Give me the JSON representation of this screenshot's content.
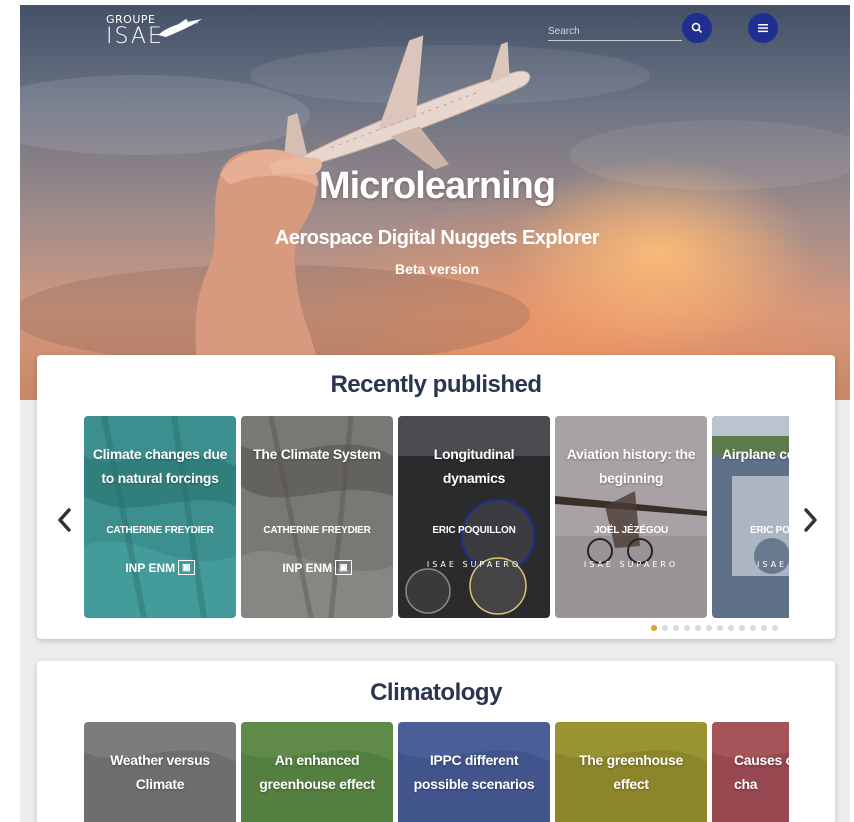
{
  "brand": {
    "logo_top": "GROUPE",
    "logo_main": "ISAE"
  },
  "header": {
    "search_placeholder": "Search",
    "search_icon": "search-icon",
    "menu_icon": "menu-icon"
  },
  "hero": {
    "title": "Microlearning",
    "subtitle": "Aerospace Digital Nuggets Explorer",
    "beta": "Beta version"
  },
  "recently": {
    "title": "Recently published",
    "cards": [
      {
        "title": "Climate changes due to natural forcings",
        "author": "CATHERINE FREYDIER",
        "logo": "INP ENM"
      },
      {
        "title": "The Climate System",
        "author": "CATHERINE FREYDIER",
        "logo": "INP ENM"
      },
      {
        "title": "Longitudinal dynamics",
        "author": "ERIC POQUILLON",
        "logo": "ISAE SUPAERO"
      },
      {
        "title": "Aviation history: the beginning",
        "author": "JOËL JÉZÉGOU",
        "logo": "ISAE SUPAERO"
      },
      {
        "title": "Airplane co",
        "author": "ERIC POC",
        "logo": "ISAE SUPA"
      }
    ],
    "dots_total": 12,
    "dots_active": 0,
    "colors": {
      "active_dot": "#e69a3a",
      "inactive_dot": "#d9d9d9"
    }
  },
  "climatology": {
    "title": "Climatology",
    "cards": [
      {
        "title": "Weather versus Climate"
      },
      {
        "title": "An enhanced greenhouse effect"
      },
      {
        "title": "IPPC different possible scenarios"
      },
      {
        "title": "The greenhouse effect"
      },
      {
        "title": "Causes o cha"
      }
    ]
  },
  "colors": {
    "accent": "#1f2f8f",
    "section_title": "#2b3550"
  }
}
